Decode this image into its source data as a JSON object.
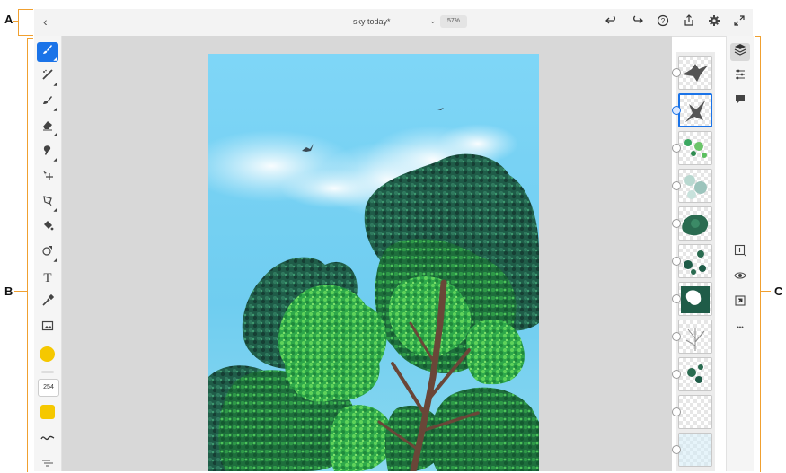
{
  "callouts": {
    "a": "A",
    "b": "B",
    "c": "C"
  },
  "topbar": {
    "back_glyph": "‹",
    "doc_title": "sky today*",
    "title_caret": "⌄",
    "zoom": "57%",
    "actions": [
      "undo-icon",
      "redo-icon",
      "help-icon",
      "share-icon",
      "settings-icon",
      "fullscreen-icon"
    ]
  },
  "toolbar": {
    "tools": [
      "brush-icon",
      "pixel-brush-icon",
      "fill-brush-icon",
      "eraser-icon",
      "smudge-icon",
      "move-transform-icon",
      "lasso-icon",
      "paint-bucket-icon",
      "shape-icon",
      "text-icon",
      "eyedropper-icon",
      "image-icon"
    ],
    "text_tool_glyph": "T",
    "brush_size": "254",
    "color_hex": "#f5c800"
  },
  "rightbar": {
    "top_icons": [
      "layers-icon",
      "properties-icon",
      "comments-icon"
    ],
    "bottom_icons": [
      "add-layer-icon",
      "visibility-icon",
      "merge-icon",
      "more-icon"
    ],
    "more_glyph": "•••"
  },
  "layers": {
    "count": 11,
    "selected_index": 1
  }
}
